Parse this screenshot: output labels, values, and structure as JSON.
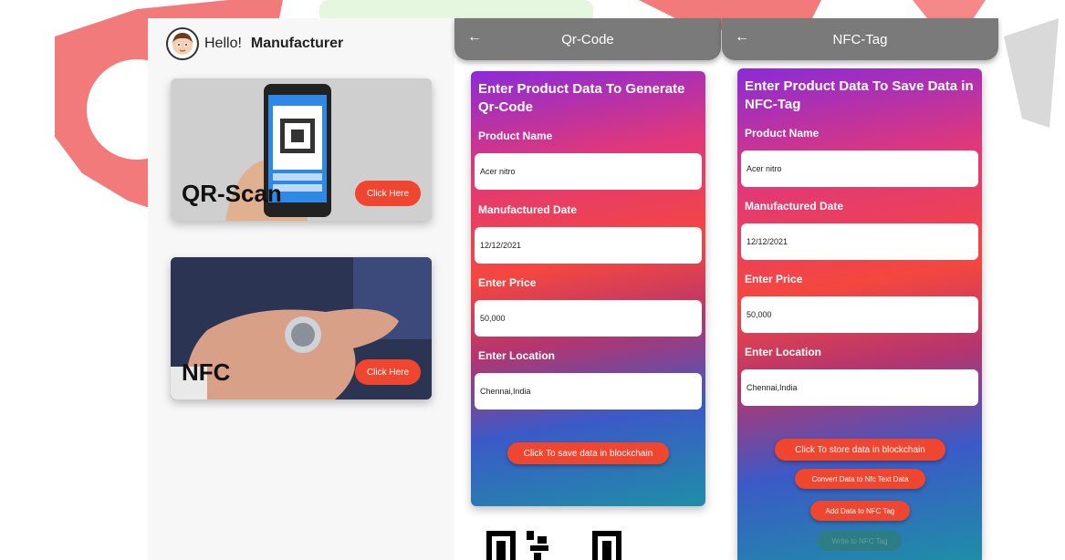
{
  "home": {
    "greeting": "Hello!",
    "user": "Manufacturer",
    "cards": [
      {
        "title": "QR-Scan",
        "button": "Click Here"
      },
      {
        "title": "NFC",
        "button": "Click Here"
      }
    ]
  },
  "qr_screen": {
    "title": "Qr-Code",
    "heading": "Enter Product Data To Generate Qr-Code",
    "fields": [
      {
        "label": "Product Name",
        "value": "Acer nitro"
      },
      {
        "label": "Manufactured Date",
        "value": "12/12/2021"
      },
      {
        "label": "Enter Price",
        "value": "50,000"
      },
      {
        "label": "Enter Location",
        "value": "Chennai,India"
      }
    ],
    "save_button": "Click To save data in blockchain"
  },
  "nfc_screen": {
    "title": "NFC-Tag",
    "heading": "Enter Product Data To Save Data in NFC-Tag",
    "fields": [
      {
        "label": "Product Name",
        "value": "Acer nitro"
      },
      {
        "label": "Manufactured Date",
        "value": "12/12/2021"
      },
      {
        "label": "Enter Price",
        "value": "50,000"
      },
      {
        "label": "Enter Location",
        "value": "Chennai,India"
      }
    ],
    "store_button": "Click To store data in blockchain",
    "convert_button": "Convert Data to Nfc Text Data",
    "add_button": "Add Data to NFC Tag",
    "write_button": "Write to NFC Tag"
  },
  "colors": {
    "accent": "#f0452f",
    "appbar": "#7a7a7a",
    "watermark_red": "#f26b6b",
    "watermark_green": "#e6f7df"
  },
  "icons": {
    "back": "arrow-left-icon",
    "avatar": "avatar-face-icon",
    "watermark": "gear-watermark-icon"
  }
}
